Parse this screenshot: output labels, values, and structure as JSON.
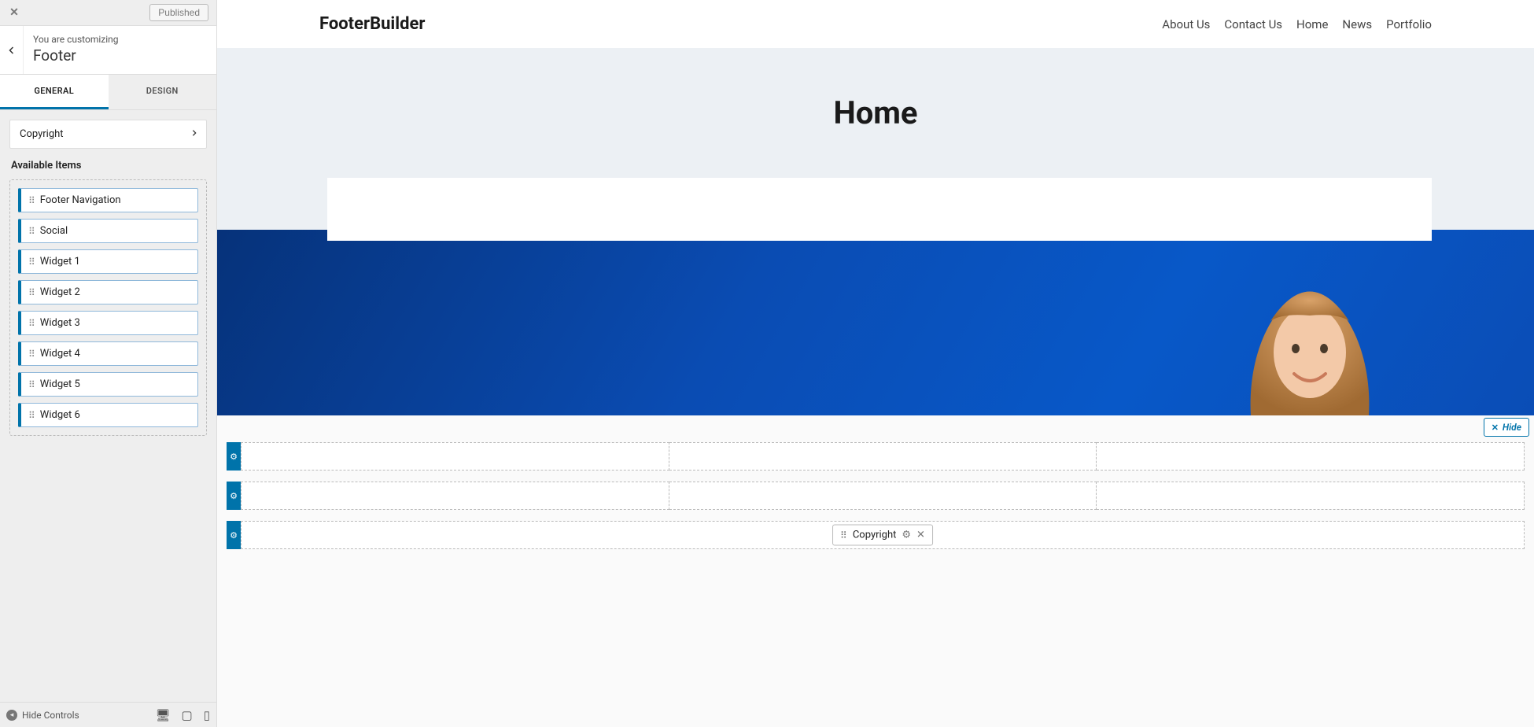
{
  "sidebar": {
    "published_label": "Published",
    "subtitle": "You are customizing",
    "title": "Footer",
    "tabs": {
      "general": "GENERAL",
      "design": "DESIGN"
    },
    "section_row": "Copyright",
    "available_title": "Available Items",
    "items": [
      "Footer Navigation",
      "Social",
      "Widget 1",
      "Widget 2",
      "Widget 3",
      "Widget 4",
      "Widget 5",
      "Widget 6"
    ],
    "hide_controls": "Hide Controls"
  },
  "site": {
    "brand": "FooterBuilder",
    "nav": [
      "About Us",
      "Contact Us",
      "Home",
      "News",
      "Portfolio"
    ],
    "hero_title": "Home"
  },
  "footer_builder": {
    "hide_label": "Hide",
    "chip_label": "Copyright"
  }
}
